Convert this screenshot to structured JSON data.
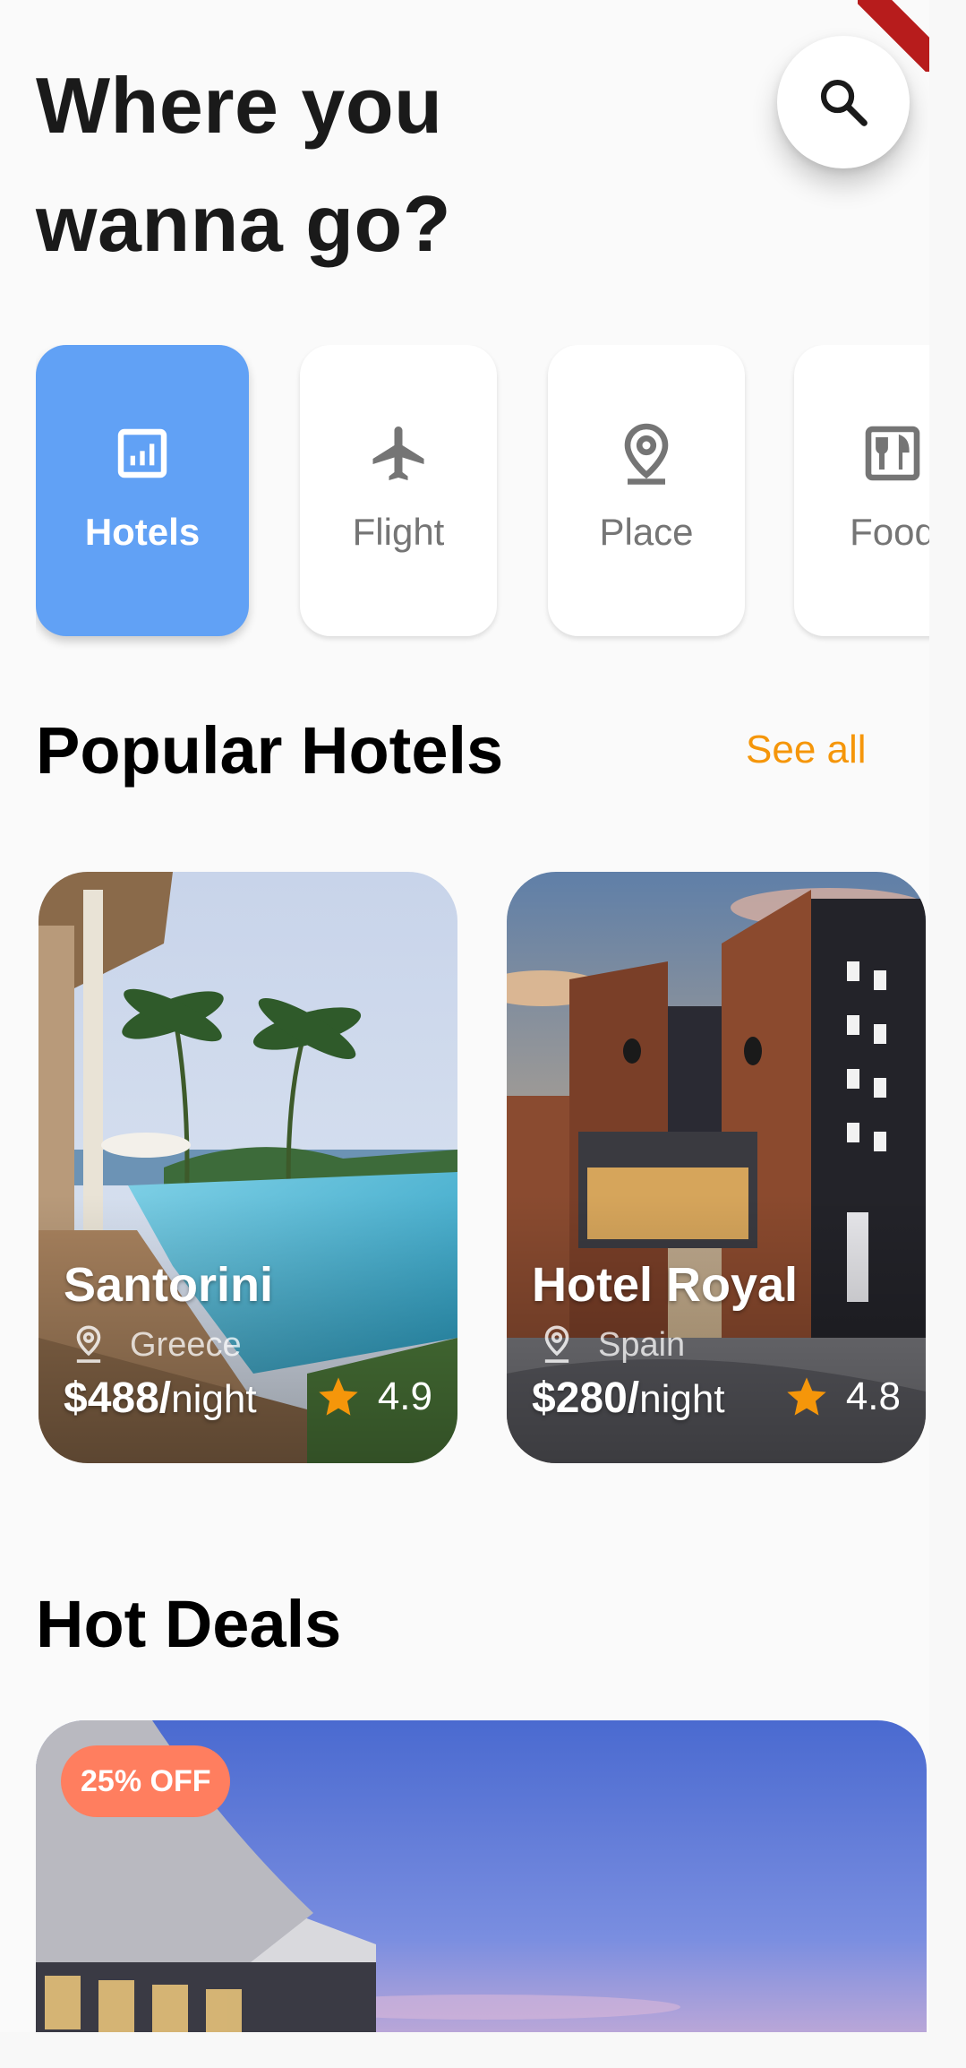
{
  "header": {
    "title_line1": "Where you",
    "title_line2": "wanna go?",
    "search_icon": "search-icon"
  },
  "categories": [
    {
      "label": "Hotels",
      "icon": "hotel-building-icon",
      "active": true
    },
    {
      "label": "Flight",
      "icon": "airplane-icon",
      "active": false
    },
    {
      "label": "Place",
      "icon": "location-pin-icon",
      "active": false
    },
    {
      "label": "Food",
      "icon": "restaurant-menu-icon",
      "active": false
    }
  ],
  "popular": {
    "title": "Popular Hotels",
    "see_all": "See all",
    "hotels": [
      {
        "name": "Santorini",
        "location": "Greece",
        "price": "$488/",
        "unit": "night",
        "rating": "4.9"
      },
      {
        "name": "Hotel Royal",
        "location": "Spain",
        "price": "$280/",
        "unit": "night",
        "rating": "4.8"
      }
    ]
  },
  "deals": {
    "title": "Hot Deals",
    "badge": "25% OFF"
  },
  "colors": {
    "accent": "#61a1f5",
    "link": "#f5960a",
    "star": "#f5960a",
    "badge": "#ff7e5f",
    "title": "#1a1a1a",
    "inactive_text": "#757575"
  }
}
